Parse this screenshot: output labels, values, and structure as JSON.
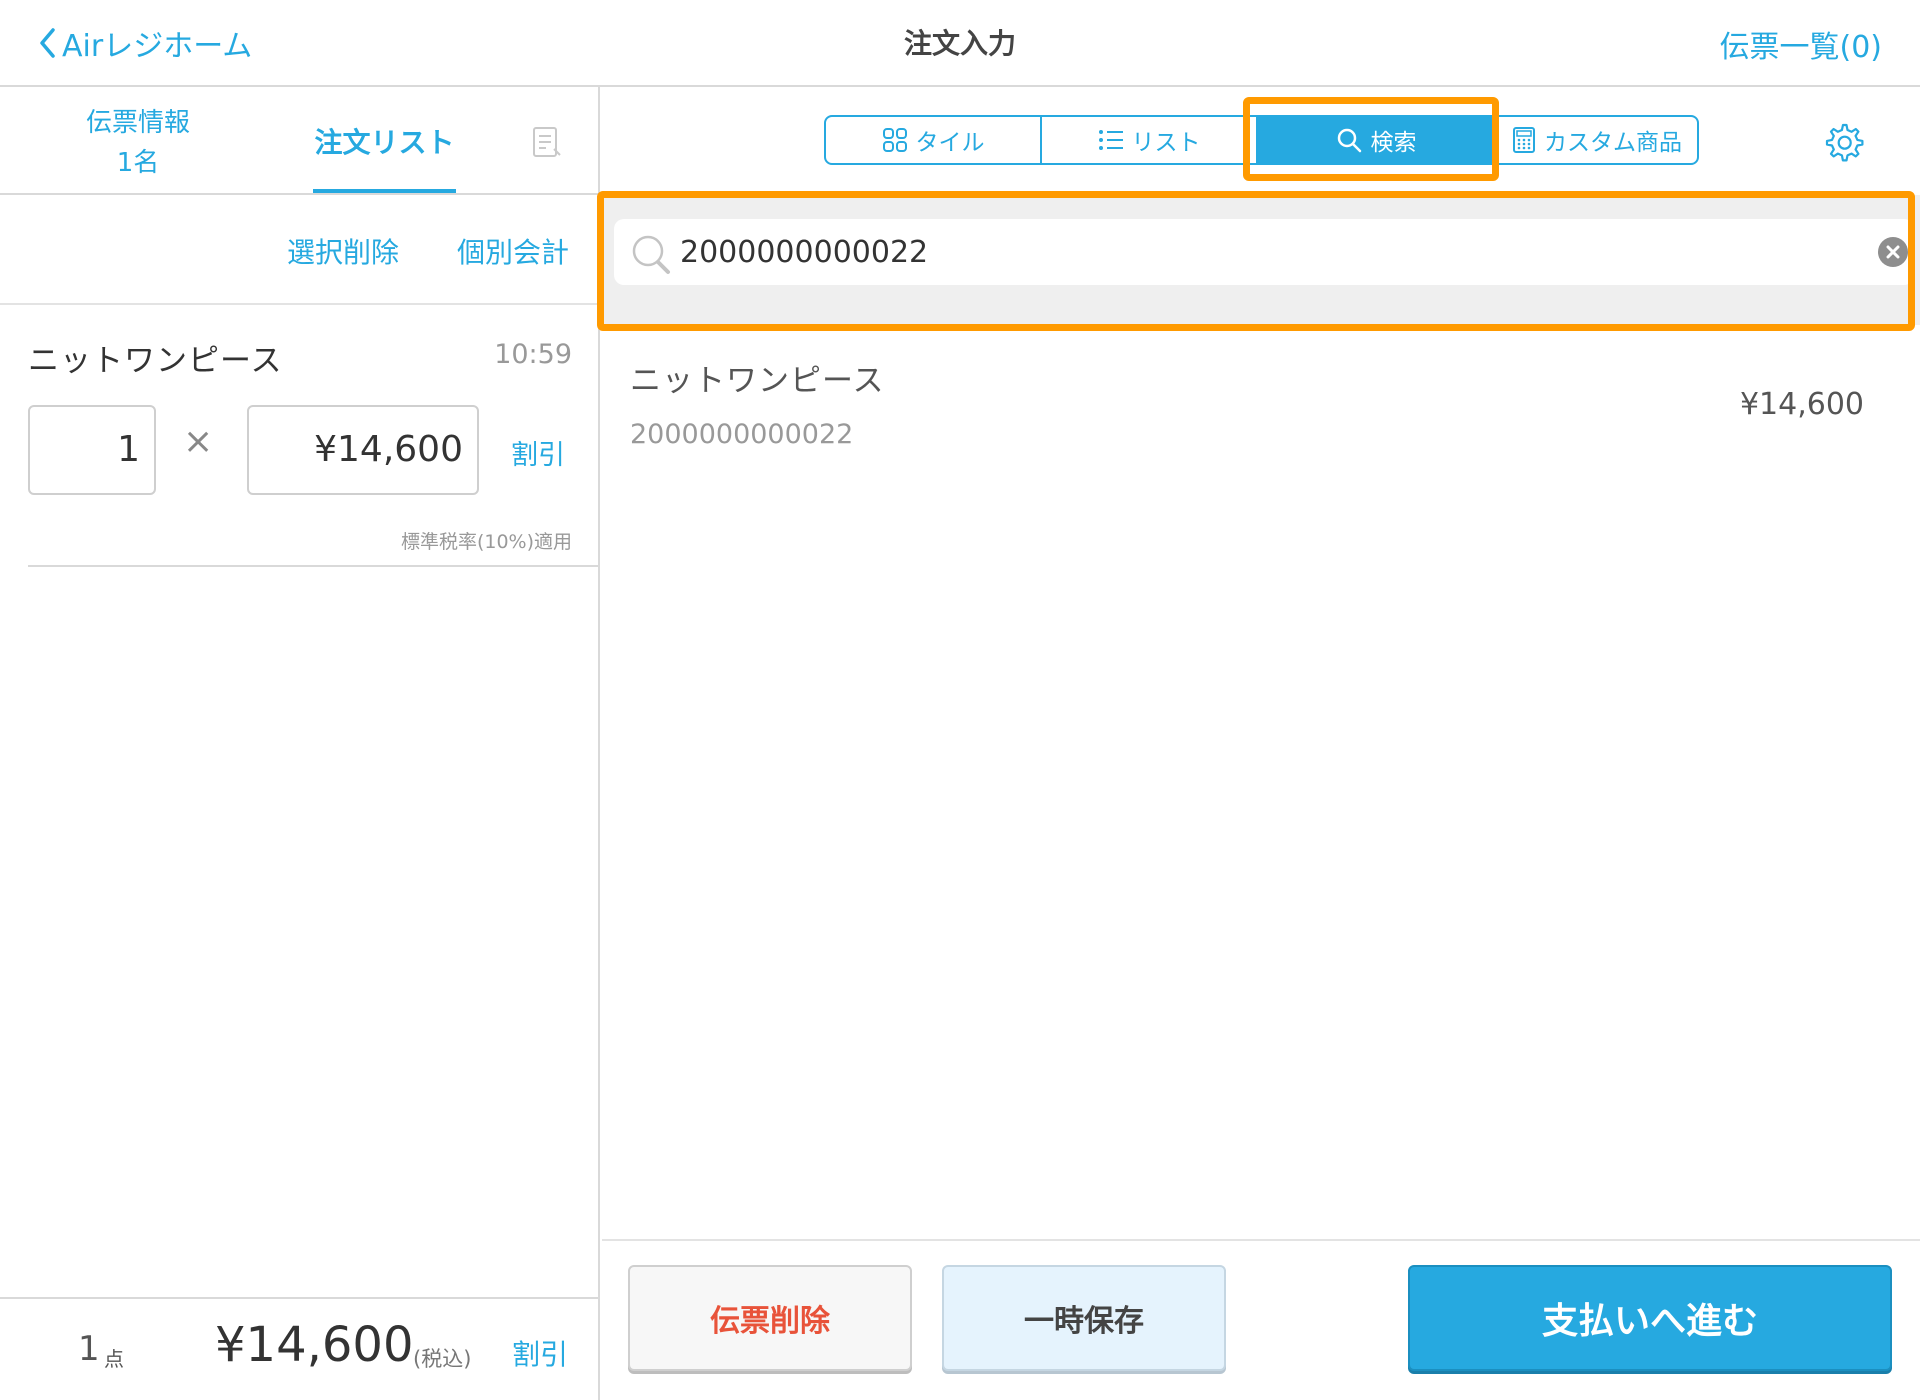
{
  "header": {
    "back_label": "Airレジホーム",
    "title": "注文入力",
    "slip_list_label": "伝票一覧(0)"
  },
  "left": {
    "tabs": {
      "slip_info_line1": "伝票情報",
      "slip_info_line2": "1名",
      "order_list": "注文リスト"
    },
    "actions": {
      "delete_selected": "選択削除",
      "individual_checkout": "個別会計"
    },
    "items": [
      {
        "name": "ニットワンピース",
        "time": "10:59",
        "quantity": "1",
        "multiply": "×",
        "price": "¥14,600",
        "discount": "割引",
        "tax_note": "標準税率(10%)適用"
      }
    ],
    "footer": {
      "count": "1",
      "count_unit": "点",
      "total": "¥14,600",
      "tax_included": "(税込)",
      "discount": "割引"
    }
  },
  "right": {
    "view_tabs": [
      {
        "label": "タイル",
        "icon": "tile-grid-icon",
        "active": false
      },
      {
        "label": "リスト",
        "icon": "list-icon",
        "active": false
      },
      {
        "label": "検索",
        "icon": "search-icon",
        "active": true
      },
      {
        "label": "カスタム商品",
        "icon": "calculator-icon",
        "active": false
      }
    ],
    "search": {
      "value": "2000000000022"
    },
    "results": [
      {
        "name": "ニットワンピース",
        "code": "2000000000022",
        "price": "¥14,600"
      }
    ],
    "buttons": {
      "delete_slip": "伝票削除",
      "hold": "一時保存",
      "pay": "支払いへ進む"
    }
  },
  "colors": {
    "accent": "#26a9e0",
    "highlight": "#ff9a00",
    "danger": "#e8533a"
  }
}
